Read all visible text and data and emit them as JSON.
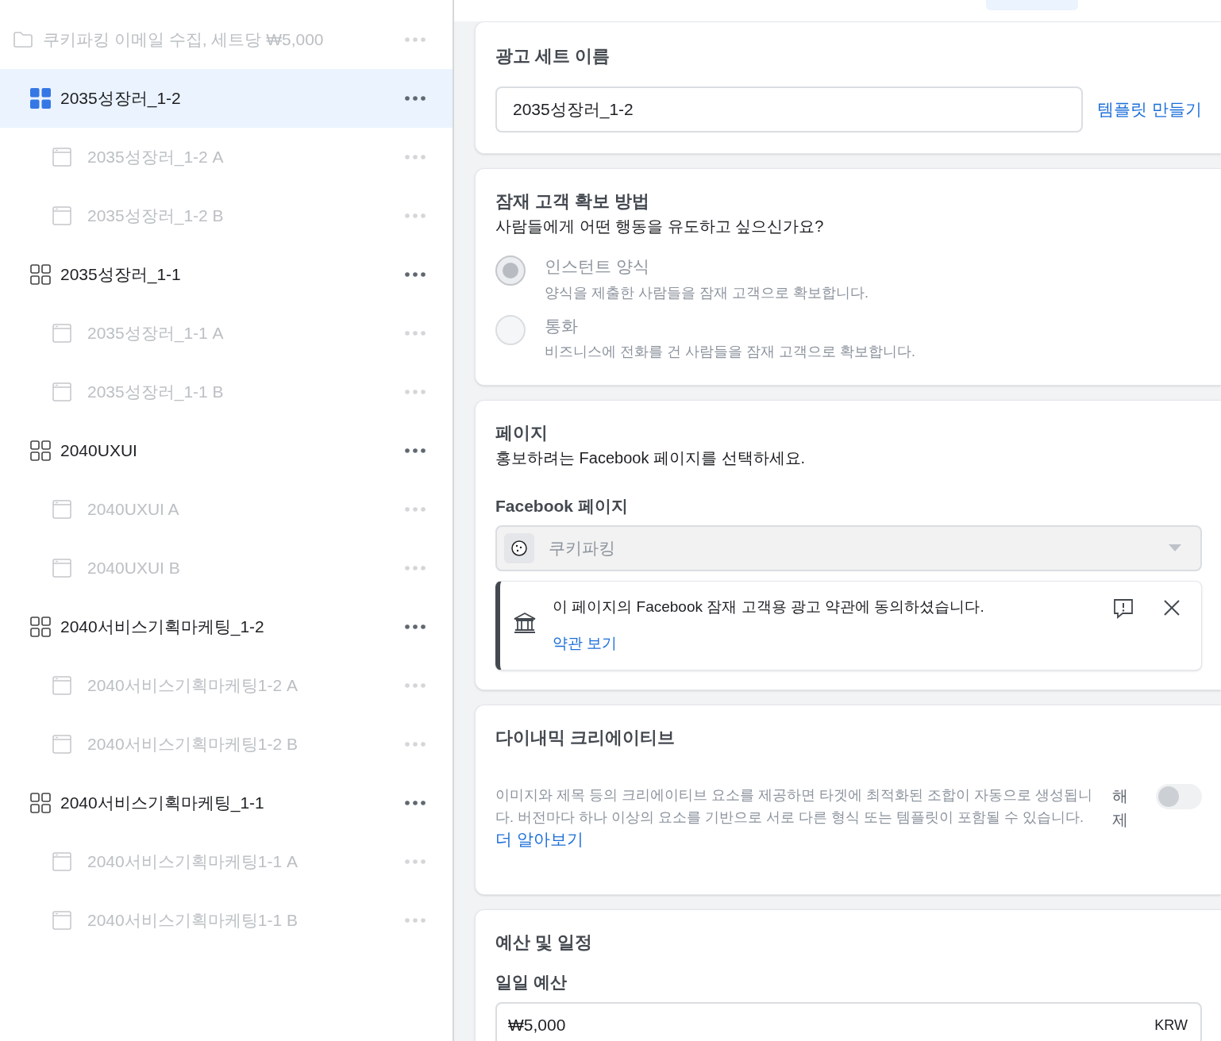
{
  "sidebar": {
    "items": [
      {
        "kind": "campaign",
        "label": "쿠키파킹 이메일 수집, 세트당 ₩5,000",
        "selected": false,
        "disabled": true,
        "children": [
          {
            "kind": "adset",
            "label": "2035성장러_1-2",
            "selected": true,
            "disabled": false,
            "children": [
              {
                "kind": "ad",
                "label": "2035성장러_1-2 A",
                "selected": false,
                "disabled": true
              },
              {
                "kind": "ad",
                "label": "2035성장러_1-2 B",
                "selected": false,
                "disabled": true
              }
            ]
          },
          {
            "kind": "adset",
            "label": "2035성장러_1-1",
            "selected": false,
            "disabled": false,
            "children": [
              {
                "kind": "ad",
                "label": "2035성장러_1-1 A",
                "selected": false,
                "disabled": true
              },
              {
                "kind": "ad",
                "label": "2035성장러_1-1 B",
                "selected": false,
                "disabled": true
              }
            ]
          },
          {
            "kind": "adset",
            "label": "2040UXUI",
            "selected": false,
            "disabled": false,
            "children": [
              {
                "kind": "ad",
                "label": "2040UXUI A",
                "selected": false,
                "disabled": true
              },
              {
                "kind": "ad",
                "label": "2040UXUI B",
                "selected": false,
                "disabled": true
              }
            ]
          },
          {
            "kind": "adset",
            "label": "2040서비스기획마케팅_1-2",
            "selected": false,
            "disabled": false,
            "children": [
              {
                "kind": "ad",
                "label": "2040서비스기획마케팅1-2 A",
                "selected": false,
                "disabled": true
              },
              {
                "kind": "ad",
                "label": "2040서비스기획마케팅1-2 B",
                "selected": false,
                "disabled": true
              }
            ]
          },
          {
            "kind": "adset",
            "label": "2040서비스기획마케팅_1-1",
            "selected": false,
            "disabled": false,
            "children": [
              {
                "kind": "ad",
                "label": "2040서비스기획마케팅1-1 A",
                "selected": false,
                "disabled": true
              },
              {
                "kind": "ad",
                "label": "2040서비스기획마케팅1-1 B",
                "selected": false,
                "disabled": true
              }
            ]
          }
        ]
      }
    ]
  },
  "adset_name": {
    "title": "광고 세트 이름",
    "value": "2035성장러_1-2",
    "link": "템플릿 만들기"
  },
  "lead_method": {
    "title": "잠재 고객 확보 방법",
    "subtitle": "사람들에게 어떤 행동을 유도하고 싶으신가요?",
    "options": [
      {
        "label": "인스턴트 양식",
        "description": "양식을 제출한 사람들을 잠재 고객으로 확보합니다.",
        "selected": true
      },
      {
        "label": "통화",
        "description": "비즈니스에 전화를 건 사람들을 잠재 고객으로 확보합니다.",
        "selected": false
      }
    ]
  },
  "page": {
    "title": "페이지",
    "subtitle": "홍보하려는 Facebook 페이지를 선택하세요.",
    "field_label": "Facebook 페이지",
    "selected_page": "쿠키파킹",
    "notice": {
      "text": "이 페이지의 Facebook 잠재 고객용 광고 약관에 동의하셨습니다.",
      "link": "약관 보기"
    }
  },
  "dynamic_creative": {
    "title": "다이내믹 크리에이티브",
    "description": "이미지와 제목 등의 크리에이티브 요소를 제공하면 타겟에 최적화된 조합이 자동으로 생성됩니다. 버전마다 하나 이상의 요소를 기반으로 서로 다른 형식 또는 템플릿이 포함될 수 있습니다.",
    "link": "더 알아보기",
    "toggle_label": "해제",
    "on": false
  },
  "budget": {
    "title": "예산 및 일정",
    "field_label": "일일 예산",
    "value": "₩5,000",
    "currency": "KRW"
  }
}
